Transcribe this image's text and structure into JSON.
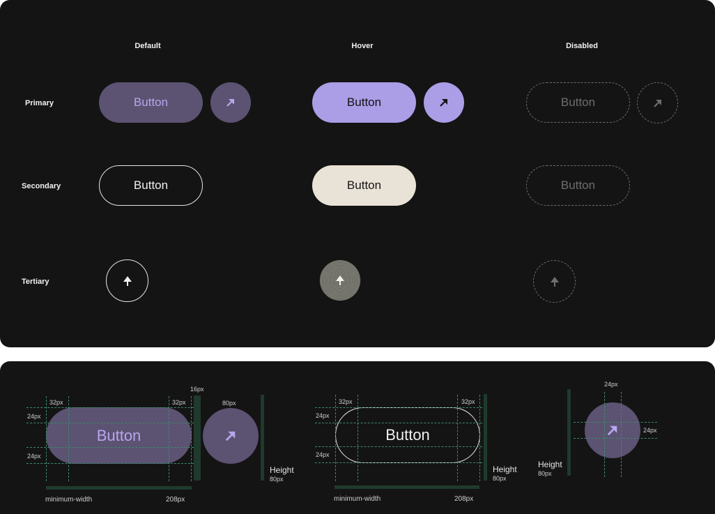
{
  "columns": {
    "default": "Default",
    "hover": "Hover",
    "disabled": "Disabled"
  },
  "rows": {
    "primary": "Primary",
    "secondary": "Secondary",
    "tertiary": "Tertiary"
  },
  "button_label": "Button",
  "icons": {
    "arrow": "arrow-up-right-icon",
    "up": "arrow-up-icon"
  },
  "colors": {
    "background": "#141414",
    "primary_default": "#5c5272",
    "primary_hover": "#ab9de6",
    "primary_text": "#b7a6ec",
    "secondary_hover": "#e9e2d6",
    "disabled": "#6e6e6e",
    "spec_guide": "#3d8c6e"
  },
  "spec": {
    "pad_32": "32px",
    "pad_24": "24px",
    "gap_16": "16px",
    "size_80": "80px",
    "height_label": "Height",
    "height_value": "80px",
    "min_width_label": "minimum-width",
    "min_width_value": "208px"
  }
}
